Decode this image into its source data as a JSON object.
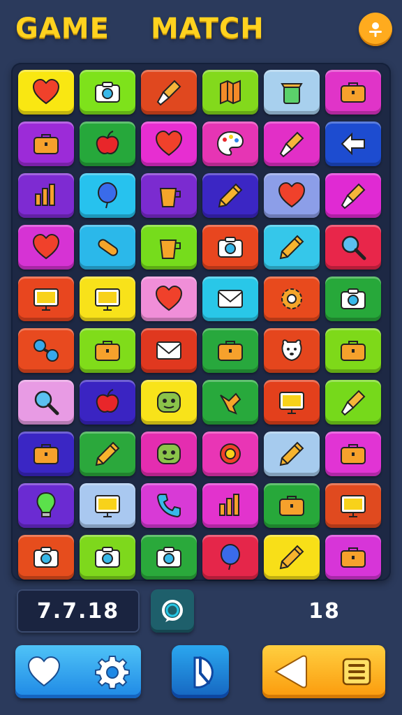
{
  "header": {
    "title_left": "GAME",
    "title_right": "MATCH",
    "profile_icon": "profile-icon"
  },
  "board": {
    "tiles": [
      {
        "color": "#f9e712",
        "icon": "heart-icon"
      },
      {
        "color": "#7ee21b",
        "icon": "camera-icon"
      },
      {
        "color": "#e0481f",
        "icon": "brush-icon"
      },
      {
        "color": "#83d91c",
        "icon": "map-icon"
      },
      {
        "color": "#a8d0ee",
        "icon": "bin-icon"
      },
      {
        "color": "#e034c8",
        "icon": "briefcase-icon"
      },
      {
        "color": "#9c2bd8",
        "icon": "briefcase-icon"
      },
      {
        "color": "#26a83b",
        "icon": "apple-icon"
      },
      {
        "color": "#e72ed1",
        "icon": "heart-icon"
      },
      {
        "color": "#e635b4",
        "icon": "palette-icon"
      },
      {
        "color": "#e22fc7",
        "icon": "brush-icon"
      },
      {
        "color": "#1d4cd0",
        "icon": "arrow-icon"
      },
      {
        "color": "#7e2bd2",
        "icon": "chart-icon"
      },
      {
        "color": "#27c2ee",
        "icon": "balloon-icon"
      },
      {
        "color": "#7b2bd0",
        "icon": "cup-icon"
      },
      {
        "color": "#3b26c4",
        "icon": "pencil-icon"
      },
      {
        "color": "#8c9ee8",
        "icon": "heart-icon"
      },
      {
        "color": "#e02ad3",
        "icon": "brush-icon"
      },
      {
        "color": "#d633d4",
        "icon": "heart-icon"
      },
      {
        "color": "#2bb8ea",
        "icon": "tube-icon"
      },
      {
        "color": "#76dc1c",
        "icon": "cup-icon"
      },
      {
        "color": "#e8461f",
        "icon": "camera-icon"
      },
      {
        "color": "#35c7ea",
        "icon": "pencil-icon"
      },
      {
        "color": "#e8264a",
        "icon": "magnifier-icon"
      },
      {
        "color": "#e8461f",
        "icon": "monitor-icon"
      },
      {
        "color": "#f8e21a",
        "icon": "monitor-icon"
      },
      {
        "color": "#f08ed8",
        "icon": "heart-icon"
      },
      {
        "color": "#29c7e8",
        "icon": "envelope-icon"
      },
      {
        "color": "#e84a1d",
        "icon": "gear-icon"
      },
      {
        "color": "#27a83a",
        "icon": "camera-icon"
      },
      {
        "color": "#e84a1f",
        "icon": "dumbbell-icon"
      },
      {
        "color": "#80dc1a",
        "icon": "briefcase-icon"
      },
      {
        "color": "#e0381f",
        "icon": "envelope-icon"
      },
      {
        "color": "#28a83d",
        "icon": "briefcase-icon"
      },
      {
        "color": "#e5461d",
        "icon": "dog-icon"
      },
      {
        "color": "#7ed919",
        "icon": "briefcase-icon"
      },
      {
        "color": "#e89be4",
        "icon": "magnifier-icon"
      },
      {
        "color": "#3a24c2",
        "icon": "apple-icon"
      },
      {
        "color": "#f8e31a",
        "icon": "face-icon"
      },
      {
        "color": "#28a93c",
        "icon": "pointer-icon"
      },
      {
        "color": "#e3401c",
        "icon": "monitor-icon"
      },
      {
        "color": "#76d91b",
        "icon": "brush-icon"
      },
      {
        "color": "#3a26c4",
        "icon": "briefcase-icon"
      },
      {
        "color": "#2ba83c",
        "icon": "pencil-icon"
      },
      {
        "color": "#e42db0",
        "icon": "face-icon"
      },
      {
        "color": "#e935b5",
        "icon": "flower-icon"
      },
      {
        "color": "#a6cbee",
        "icon": "pencil-icon"
      },
      {
        "color": "#e134d4",
        "icon": "briefcase-icon"
      },
      {
        "color": "#6b2bd2",
        "icon": "bulb-icon"
      },
      {
        "color": "#a9c8f0",
        "icon": "monitor-icon"
      },
      {
        "color": "#d83ad6",
        "icon": "phone-icon"
      },
      {
        "color": "#e233cd",
        "icon": "chart-icon"
      },
      {
        "color": "#27a83a",
        "icon": "briefcase-icon"
      },
      {
        "color": "#e04a1f",
        "icon": "monitor-icon"
      },
      {
        "color": "#e64d1d",
        "icon": "camera-icon"
      },
      {
        "color": "#7ed81c",
        "icon": "camera-icon"
      },
      {
        "color": "#2aa93b",
        "icon": "camera-icon"
      },
      {
        "color": "#e5264a",
        "icon": "balloon-icon"
      },
      {
        "color": "#f8df18",
        "icon": "pencil-icon"
      },
      {
        "color": "#d735d8",
        "icon": "briefcase-icon"
      }
    ]
  },
  "status": {
    "score": "7.7.18",
    "hint_icon": "hint-icon",
    "count": "18"
  },
  "controls": {
    "heart_icon": "heart-icon",
    "settings_icon": "gear-icon",
    "power_icon": "power-icon",
    "back_icon": "back-icon",
    "menu_icon": "menu-icon"
  }
}
